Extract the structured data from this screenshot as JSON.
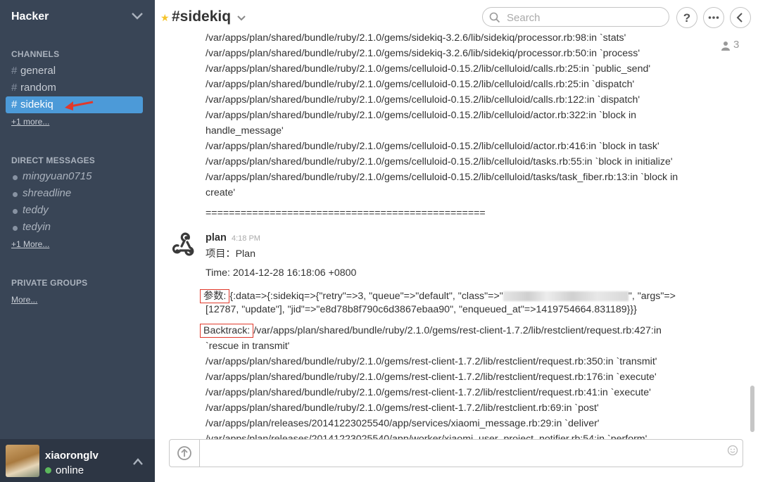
{
  "team": {
    "name": "Hacker"
  },
  "sidebar": {
    "channels_title": "CHANNELS",
    "channels": [
      {
        "label": "general"
      },
      {
        "label": "random"
      },
      {
        "label": "sidekiq",
        "active": true
      }
    ],
    "hash": "#",
    "channels_more": "+1 more...",
    "dm_title": "DIRECT MESSAGES",
    "dms": [
      {
        "label": "mingyuan0715"
      },
      {
        "label": "shreadline"
      },
      {
        "label": "teddy"
      },
      {
        "label": "tedyin"
      }
    ],
    "dm_more": "+1 More...",
    "groups_title": "PRIVATE GROUPS",
    "groups_more": "More..."
  },
  "user": {
    "name": "xiaoronglv",
    "status": "online"
  },
  "header": {
    "channel": "#sidekiq",
    "search_placeholder": "Search",
    "member_count": "3"
  },
  "messages": {
    "trace_lines": [
      "/var/apps/plan/shared/bundle/ruby/2.1.0/gems/sidekiq-3.2.6/lib/sidekiq/processor.rb:98:in `stats'",
      "/var/apps/plan/shared/bundle/ruby/2.1.0/gems/sidekiq-3.2.6/lib/sidekiq/processor.rb:50:in `process'",
      "/var/apps/plan/shared/bundle/ruby/2.1.0/gems/celluloid-0.15.2/lib/celluloid/calls.rb:25:in `public_send'",
      "/var/apps/plan/shared/bundle/ruby/2.1.0/gems/celluloid-0.15.2/lib/celluloid/calls.rb:25:in `dispatch'",
      "/var/apps/plan/shared/bundle/ruby/2.1.0/gems/celluloid-0.15.2/lib/celluloid/calls.rb:122:in `dispatch'",
      "/var/apps/plan/shared/bundle/ruby/2.1.0/gems/celluloid-0.15.2/lib/celluloid/actor.rb:322:in `block in",
      "handle_message'",
      "/var/apps/plan/shared/bundle/ruby/2.1.0/gems/celluloid-0.15.2/lib/celluloid/actor.rb:416:in `block in task'",
      "/var/apps/plan/shared/bundle/ruby/2.1.0/gems/celluloid-0.15.2/lib/celluloid/tasks.rb:55:in `block in initialize'",
      "/var/apps/plan/shared/bundle/ruby/2.1.0/gems/celluloid-0.15.2/lib/celluloid/tasks/task_fiber.rb:13:in `block in",
      "create'"
    ],
    "separator": "================================================",
    "sender": "plan",
    "time": "4:18 PM",
    "project_line": "项目：Plan",
    "time_line": "Time: 2014-12-28 16:18:06 +0800",
    "params_label": "参数:",
    "params_line1a": "{:data=>{:sidekiq=>{\"retry\"=>3, \"queue\"=>\"default\", \"class\"=>\"",
    "params_line1b": "\", \"args\"=>",
    "params_line2": "[12787, \"update\"], \"jid\"=>\"e8d78b8f790c6d3867ebaa90\", \"enqueued_at\"=>1419754664.831189}}}",
    "backtrack_label": "Backtrack:",
    "backtrack_first": "/var/apps/plan/shared/bundle/ruby/2.1.0/gems/rest-client-1.7.2/lib/restclient/request.rb:427:in",
    "backtrack_lines": [
      "`rescue in transmit'",
      "/var/apps/plan/shared/bundle/ruby/2.1.0/gems/rest-client-1.7.2/lib/restclient/request.rb:350:in `transmit'",
      "/var/apps/plan/shared/bundle/ruby/2.1.0/gems/rest-client-1.7.2/lib/restclient/request.rb:176:in `execute'",
      "/var/apps/plan/shared/bundle/ruby/2.1.0/gems/rest-client-1.7.2/lib/restclient/request.rb:41:in `execute'",
      "/var/apps/plan/shared/bundle/ruby/2.1.0/gems/rest-client-1.7.2/lib/restclient.rb:69:in `post'",
      "/var/apps/plan/releases/20141223025540/app/services/xiaomi_message.rb:29:in `deliver'",
      "/var/apps/plan/releases/20141223025540/app/worker/xiaomi_user_project_notifier.rb:54:in `perform'"
    ]
  },
  "icons": {
    "chevron": "chevron-down-icon",
    "star": "star-icon",
    "search": "search-icon",
    "help": "question-icon",
    "more": "ellipsis-icon",
    "back": "chevron-left-icon",
    "webhook": "webhook-icon",
    "upload": "upload-icon",
    "emoji": "emoji-icon"
  },
  "colors": {
    "sidebar_bg": "#394556",
    "active_channel": "#4c9ad8",
    "online": "#5cb85c",
    "highlight_box": "#e0392b",
    "star": "#f5c42b"
  }
}
